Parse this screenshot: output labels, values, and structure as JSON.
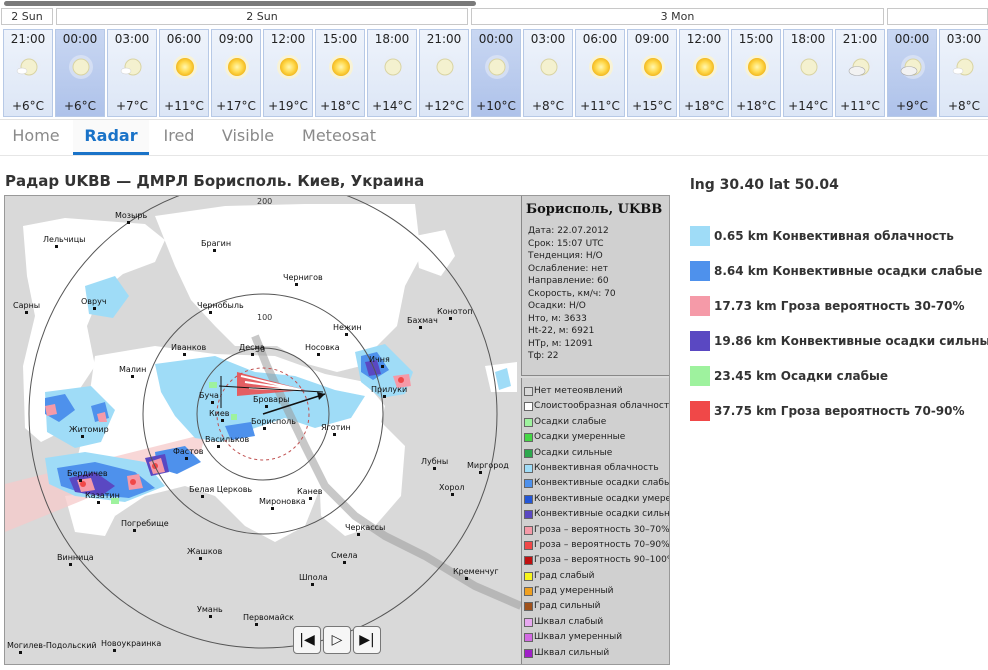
{
  "days": [
    "2 Sun",
    "2 Sun",
    "3 Mon",
    ""
  ],
  "hours": [
    {
      "time": "21:00",
      "temp": "+6°C",
      "icon": "moon-partly-cloudy-icon",
      "night": false
    },
    {
      "time": "00:00",
      "temp": "+6°C",
      "icon": "moon-clear-icon",
      "night": true
    },
    {
      "time": "03:00",
      "temp": "+7°C",
      "icon": "moon-partly-cloudy-icon",
      "night": false
    },
    {
      "time": "06:00",
      "temp": "+11°C",
      "icon": "sun-icon",
      "night": false
    },
    {
      "time": "09:00",
      "temp": "+17°C",
      "icon": "sun-icon",
      "night": false
    },
    {
      "time": "12:00",
      "temp": "+19°C",
      "icon": "sun-icon",
      "night": false
    },
    {
      "time": "15:00",
      "temp": "+18°C",
      "icon": "sun-icon",
      "night": false
    },
    {
      "time": "18:00",
      "temp": "+14°C",
      "icon": "moon-clear-icon",
      "night": false
    },
    {
      "time": "21:00",
      "temp": "+12°C",
      "icon": "moon-clear-icon",
      "night": false
    },
    {
      "time": "00:00",
      "temp": "+10°C",
      "icon": "moon-clear-icon",
      "night": true
    },
    {
      "time": "03:00",
      "temp": "+8°C",
      "icon": "moon-clear-icon",
      "night": false
    },
    {
      "time": "06:00",
      "temp": "+11°C",
      "icon": "sun-icon",
      "night": false
    },
    {
      "time": "09:00",
      "temp": "+15°C",
      "icon": "sun-icon",
      "night": false
    },
    {
      "time": "12:00",
      "temp": "+18°C",
      "icon": "sun-icon",
      "night": false
    },
    {
      "time": "15:00",
      "temp": "+18°C",
      "icon": "sun-icon",
      "night": false
    },
    {
      "time": "18:00",
      "temp": "+14°C",
      "icon": "moon-clear-icon",
      "night": false
    },
    {
      "time": "21:00",
      "temp": "+11°C",
      "icon": "moon-cloudy-icon",
      "night": false
    },
    {
      "time": "00:00",
      "temp": "+9°C",
      "icon": "moon-cloudy-icon",
      "night": true
    },
    {
      "time": "03:00",
      "temp": "+8°C",
      "icon": "moon-partly-cloudy-icon",
      "night": false
    }
  ],
  "tabs": [
    "Home",
    "Radar",
    "Ired",
    "Visible",
    "Meteosat"
  ],
  "active_tab": "Radar",
  "radar_title": "Радар UKBB — ДМРЛ Борисполь. Киев, Украина",
  "info": {
    "title": "Борисполь, UKBB",
    "lines": [
      "Дата: 22.07.2012",
      "Срок: 15:07 UTC",
      "Тенденция: Н/О",
      "Ослабление: нет",
      "Направление: 60",
      "Скорость, км/ч: 70",
      "Осадки: Н/О",
      "Нто, м: 3633",
      "Нt-22, м: 6921",
      "НТр, м: 12091",
      "Тф: 22"
    ]
  },
  "legend": [
    {
      "label": "Нет метеоявлений",
      "color": "#d9d9d9"
    },
    {
      "label": "Слоистообразная облачность",
      "color": "#ffffff"
    },
    {
      "label": "Осадки слабые",
      "color": "#9ef29e"
    },
    {
      "label": "Осадки умеренные",
      "color": "#45d645"
    },
    {
      "label": "Осадки сильные",
      "color": "#2ea84e"
    },
    {
      "label": "Конвективная облачность",
      "color": "#9fdcf7"
    },
    {
      "label": "Конвективные осадки слабые",
      "color": "#4e91ec"
    },
    {
      "label": "Конвективные осадки умерен.",
      "color": "#2457d6"
    },
    {
      "label": "Конвективные осадки сильные",
      "color": "#5a48c2"
    },
    {
      "label": "Гроза – вероятность 30–70%",
      "color": "#f59aa8"
    },
    {
      "label": "Гроза – вероятность 70–90%",
      "color": "#f04848"
    },
    {
      "label": "Гроза – вероятность 90–100%",
      "color": "#c01010"
    },
    {
      "label": "Град слабый",
      "color": "#f7f41c"
    },
    {
      "label": "Град умеренный",
      "color": "#f0a020"
    },
    {
      "label": "Град сильный",
      "color": "#a0521c"
    },
    {
      "label": "Шквал слабый",
      "color": "#e7a8f0"
    },
    {
      "label": "Шквал умеренный",
      "color": "#d26ae2"
    },
    {
      "label": "Шквал сильный",
      "color": "#a020c8"
    }
  ],
  "cities": [
    {
      "name": "Мозырь"
    },
    {
      "name": "Лельчицы"
    },
    {
      "name": "Брагин"
    },
    {
      "name": "Чернигов"
    },
    {
      "name": "Сарны"
    },
    {
      "name": "Овруч"
    },
    {
      "name": "Чернобыль"
    },
    {
      "name": "Бахмач"
    },
    {
      "name": "Конотоп"
    },
    {
      "name": "Нежин"
    },
    {
      "name": "Иванков"
    },
    {
      "name": "Десна"
    },
    {
      "name": "Носовка"
    },
    {
      "name": "Ичня"
    },
    {
      "name": "Малин"
    },
    {
      "name": "Прилуки"
    },
    {
      "name": "Буча"
    },
    {
      "name": "Бровары"
    },
    {
      "name": "Киев"
    },
    {
      "name": "Борисполь"
    },
    {
      "name": "Житомир"
    },
    {
      "name": "Яготин"
    },
    {
      "name": "Васильков"
    },
    {
      "name": "Фастов"
    },
    {
      "name": "Лубны"
    },
    {
      "name": "Бердичев"
    },
    {
      "name": "Миргород"
    },
    {
      "name": "Казатин"
    },
    {
      "name": "Белая Церковь"
    },
    {
      "name": "Хорол"
    },
    {
      "name": "Канев"
    },
    {
      "name": "Мироновка"
    },
    {
      "name": "Погребище"
    },
    {
      "name": "Черкассы"
    },
    {
      "name": "Винница"
    },
    {
      "name": "Смела"
    },
    {
      "name": "Жашков"
    },
    {
      "name": "Кременчуг"
    },
    {
      "name": "Шпола"
    },
    {
      "name": "Умань"
    },
    {
      "name": "Первомайск"
    },
    {
      "name": "Новоукраинка"
    },
    {
      "name": "Могилев-Подольский"
    },
    {
      "name": "Бахмач"
    }
  ],
  "range_rings": [
    "50",
    "100",
    "200"
  ],
  "coords": "lng 30.40 lat 50.04",
  "echo_tops": [
    {
      "label": "0.65 km Конвективная облачность",
      "color": "#9fdcf7"
    },
    {
      "label": "8.64 km Конвективные осадки слабые",
      "color": "#4e91ec"
    },
    {
      "label": "17.73 km Гроза вероятность 30-70%",
      "color": "#f59aa8"
    },
    {
      "label": "19.86 km Конвективные осадки сильные",
      "color": "#5a48c2"
    },
    {
      "label": "23.45 km Осадки слабые",
      "color": "#9ef29e"
    },
    {
      "label": "37.75 km Гроза вероятность 70-90%",
      "color": "#f04848"
    }
  ],
  "player": {
    "prev": "|◀",
    "play": "▷",
    "next": "▶|"
  }
}
